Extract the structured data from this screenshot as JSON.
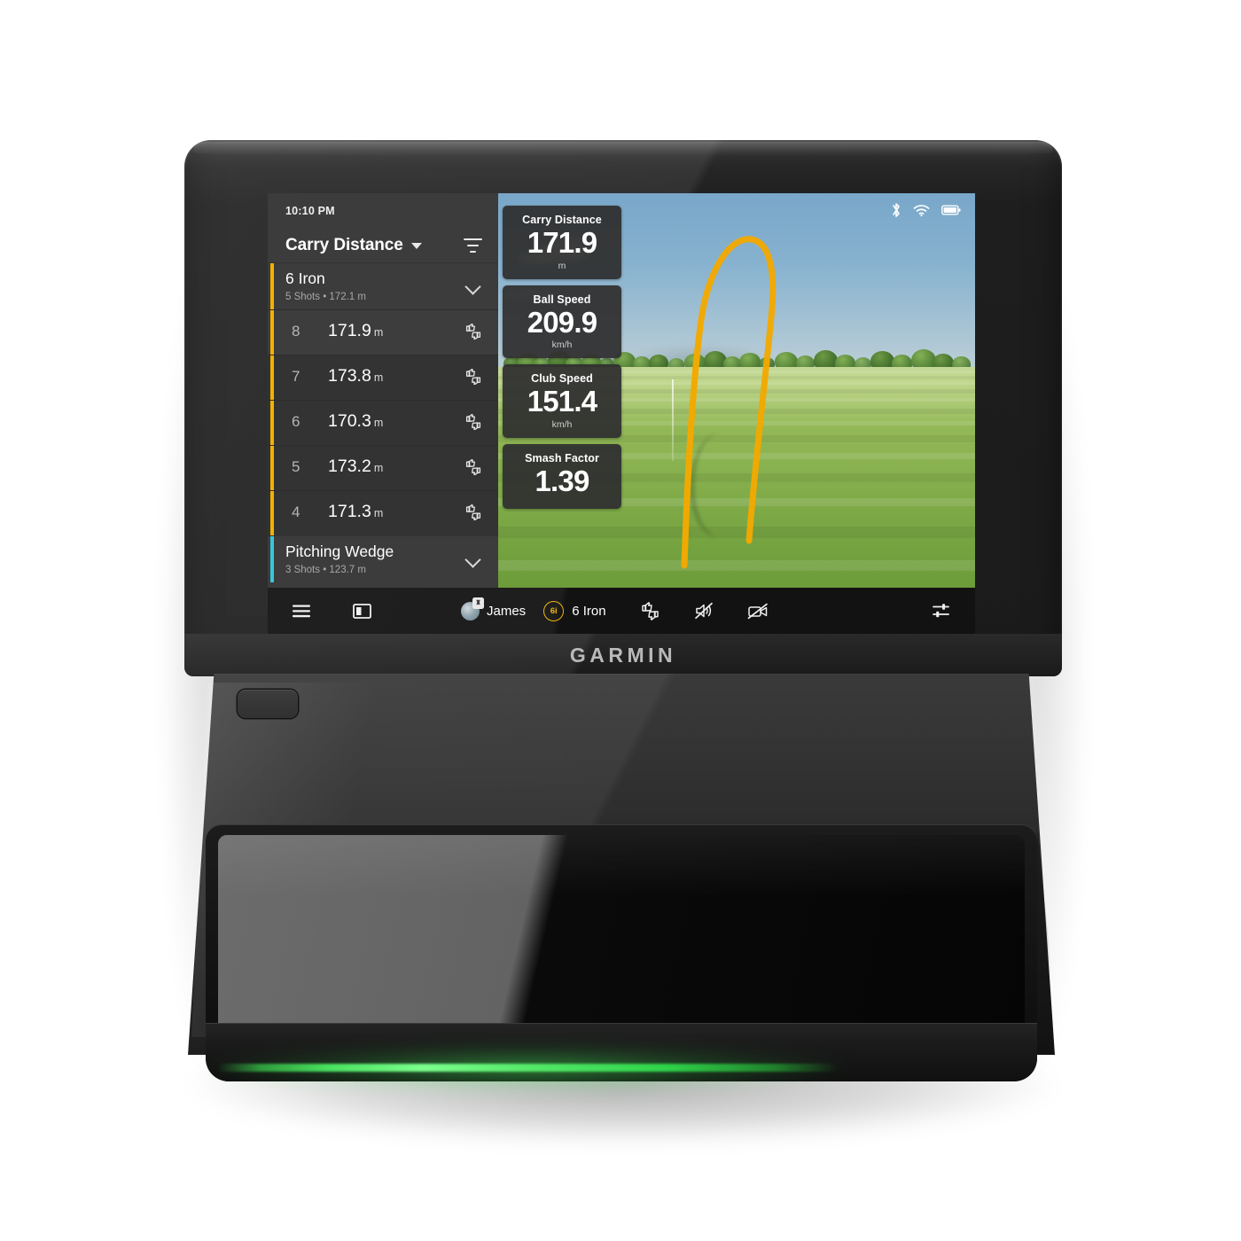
{
  "device": {
    "brand": "GARMIN",
    "led_color": "#49e15f",
    "power_button_name": "power-button"
  },
  "screen": {
    "status_bar": {
      "clock": "10:10 PM",
      "icons": [
        "bluetooth-icon",
        "wifi-icon",
        "battery-icon"
      ]
    },
    "sidebar": {
      "title": "Carry Distance",
      "dropdown_icon": "chevron-down-icon",
      "filter_icon": "filter-icon",
      "groups": [
        {
          "name": "6 Iron",
          "subtitle": "5 Shots • 172.1 m",
          "accent": "#f2b200",
          "expanded": true,
          "shots": [
            {
              "index": "8",
              "value": "171.9",
              "unit": "m",
              "selected": true
            },
            {
              "index": "7",
              "value": "173.8",
              "unit": "m",
              "selected": false
            },
            {
              "index": "6",
              "value": "170.3",
              "unit": "m",
              "selected": false
            },
            {
              "index": "5",
              "value": "173.2",
              "unit": "m",
              "selected": false
            },
            {
              "index": "4",
              "value": "171.3",
              "unit": "m",
              "selected": false
            }
          ]
        },
        {
          "name": "Pitching Wedge",
          "subtitle": "3 Shots • 123.7 m",
          "accent": "#38c6d9",
          "expanded": false,
          "shots": []
        }
      ]
    },
    "metrics": [
      {
        "label": "Carry Distance",
        "value": "171.9",
        "unit": "m"
      },
      {
        "label": "Ball Speed",
        "value": "209.9",
        "unit": "km/h"
      },
      {
        "label": "Club Speed",
        "value": "151.4",
        "unit": "km/h"
      },
      {
        "label": "Smash Factor",
        "value": "1.39",
        "unit": ""
      }
    ],
    "simulation": {
      "trajectory_color": "#f2a900",
      "sky_color": "#87b2cf",
      "grass_color": "#8cb452"
    },
    "toolbar": {
      "menu_icon": "hamburger-menu-icon",
      "layout_icon": "panel-layout-icon",
      "user_name": "James",
      "user_badge": "♜",
      "club_badge": "6i",
      "club_name": "6 Iron",
      "feedback_icon": "thumbs-up-down-icon",
      "mute_icon": "speaker-muted-icon",
      "camera_icon": "camera-off-icon",
      "settings_icon": "sliders-icon"
    }
  }
}
